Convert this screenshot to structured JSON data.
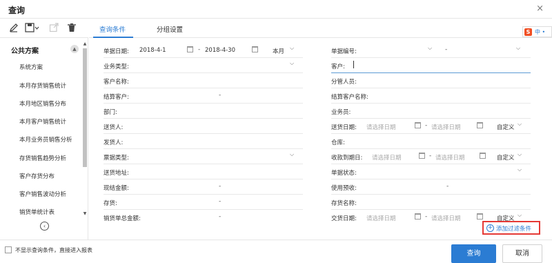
{
  "window": {
    "title": "查询",
    "close_glyph": "×"
  },
  "toolbar": {
    "edit_icon": "pencil-icon",
    "save_icon": "save-icon",
    "save_glyph": "💾▾",
    "export_icon": "external-link-icon",
    "delete_icon": "trash-icon"
  },
  "sidebar": {
    "header": "公共方案",
    "items": [
      "系统方案",
      "本月存货销售统计",
      "本月地区销售分布",
      "本月客户销售统计",
      "本月业务员销售分析",
      "存货销售趋势分析",
      "客户存货分布",
      "客户销售波动分析",
      "销货单统计表"
    ]
  },
  "tabs": [
    {
      "label": "查询条件",
      "active": true
    },
    {
      "label": "分组设置",
      "active": false
    }
  ],
  "ime": {
    "logo": "S",
    "text": "中 •"
  },
  "form": {
    "left": [
      {
        "label": "单据日期:",
        "start": "2018-4-1",
        "end": "2018-4-30",
        "period": "本月"
      },
      {
        "label": "业务类型:"
      },
      {
        "label": "客户名称:"
      },
      {
        "label": "结算客户:",
        "dash": "-"
      },
      {
        "label": "部门:"
      },
      {
        "label": "送货人:"
      },
      {
        "label": "发货人:"
      },
      {
        "label": "票据类型:"
      },
      {
        "label": "送货地址:"
      },
      {
        "label": "现结金额:",
        "dash": "-"
      },
      {
        "label": "存货:",
        "dash": "-"
      },
      {
        "label": "销货单总金额:",
        "dash": "-"
      }
    ],
    "right": [
      {
        "label": "单据编号:",
        "dash": "-"
      },
      {
        "label": "客户:"
      },
      {
        "label": "分管人员:"
      },
      {
        "label": "结算客户名称:"
      },
      {
        "label": "业务员:"
      },
      {
        "label": "送货日期:",
        "placeholder": "请选择日期",
        "period": "自定义"
      },
      {
        "label": "仓库:"
      },
      {
        "label": "收款到期日:",
        "placeholder": "请选择日期",
        "period": "自定义"
      },
      {
        "label": "单据状态:"
      },
      {
        "label": "使用预收:",
        "dash": "-"
      },
      {
        "label": "存货名称:"
      },
      {
        "label": "交货日期:",
        "placeholder": "请选择日期",
        "period": "自定义"
      }
    ]
  },
  "add_filter": {
    "label": "添加过滤条件"
  },
  "footer": {
    "skip_label": "不显示查询条件，直接进入报表",
    "query_button": "查询",
    "cancel_button": "取消"
  }
}
